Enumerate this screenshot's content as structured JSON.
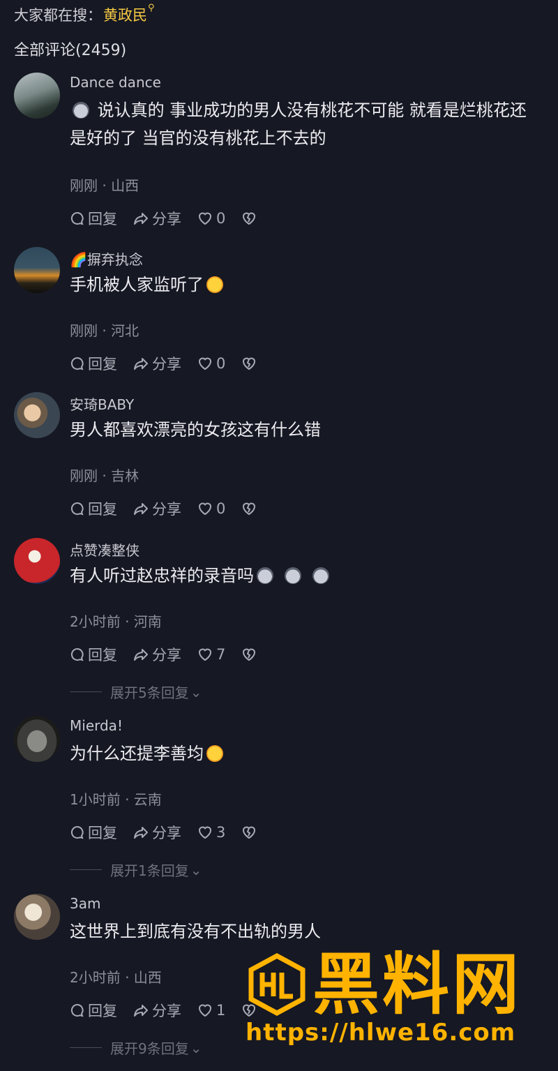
{
  "search": {
    "prefix": "大家都在搜：",
    "keyword": "黄政民"
  },
  "comments_total": "全部评论(2459)",
  "labels": {
    "reply": "回复",
    "share": "分享"
  },
  "comments": [
    {
      "name": "Dance dance",
      "text_line1": " 说认真的 事业成功的男人没有桃花不可能 就看是烂桃花还",
      "text_line2": "是好的了 当官的没有桃花上不去的",
      "meta": "刚刚 · 山西",
      "likes": "0"
    },
    {
      "name": "摒弃执念",
      "text_line1": "手机被人家监听了",
      "meta": "刚刚 · 河北",
      "likes": "0"
    },
    {
      "name": "安琦BABY",
      "text_line1": "男人都喜欢漂亮的女孩这有什么错",
      "meta": "刚刚 · 吉林",
      "likes": "0"
    },
    {
      "name": "点赞凑整侠",
      "text_line1": "有人听过赵忠祥的录音吗",
      "meta": "2小时前 · 河南",
      "likes": "7",
      "expand": "展开5条回复"
    },
    {
      "name": "Mierda!",
      "text_line1": "为什么还提李善均",
      "meta": "1小时前 · 云南",
      "likes": "3",
      "expand": "展开1条回复"
    },
    {
      "name": "3am",
      "text_line1": "这世界上到底有没有不出轨的男人",
      "meta": "2小时前 · 山西",
      "likes": "1",
      "expand": "展开9条回复"
    }
  ],
  "watermark": {
    "title": "黑料网",
    "url": "https://hlwe16.com"
  },
  "colors": {
    "background": "#161823",
    "keyword": "#f6c944",
    "watermark": "#ffb300"
  }
}
